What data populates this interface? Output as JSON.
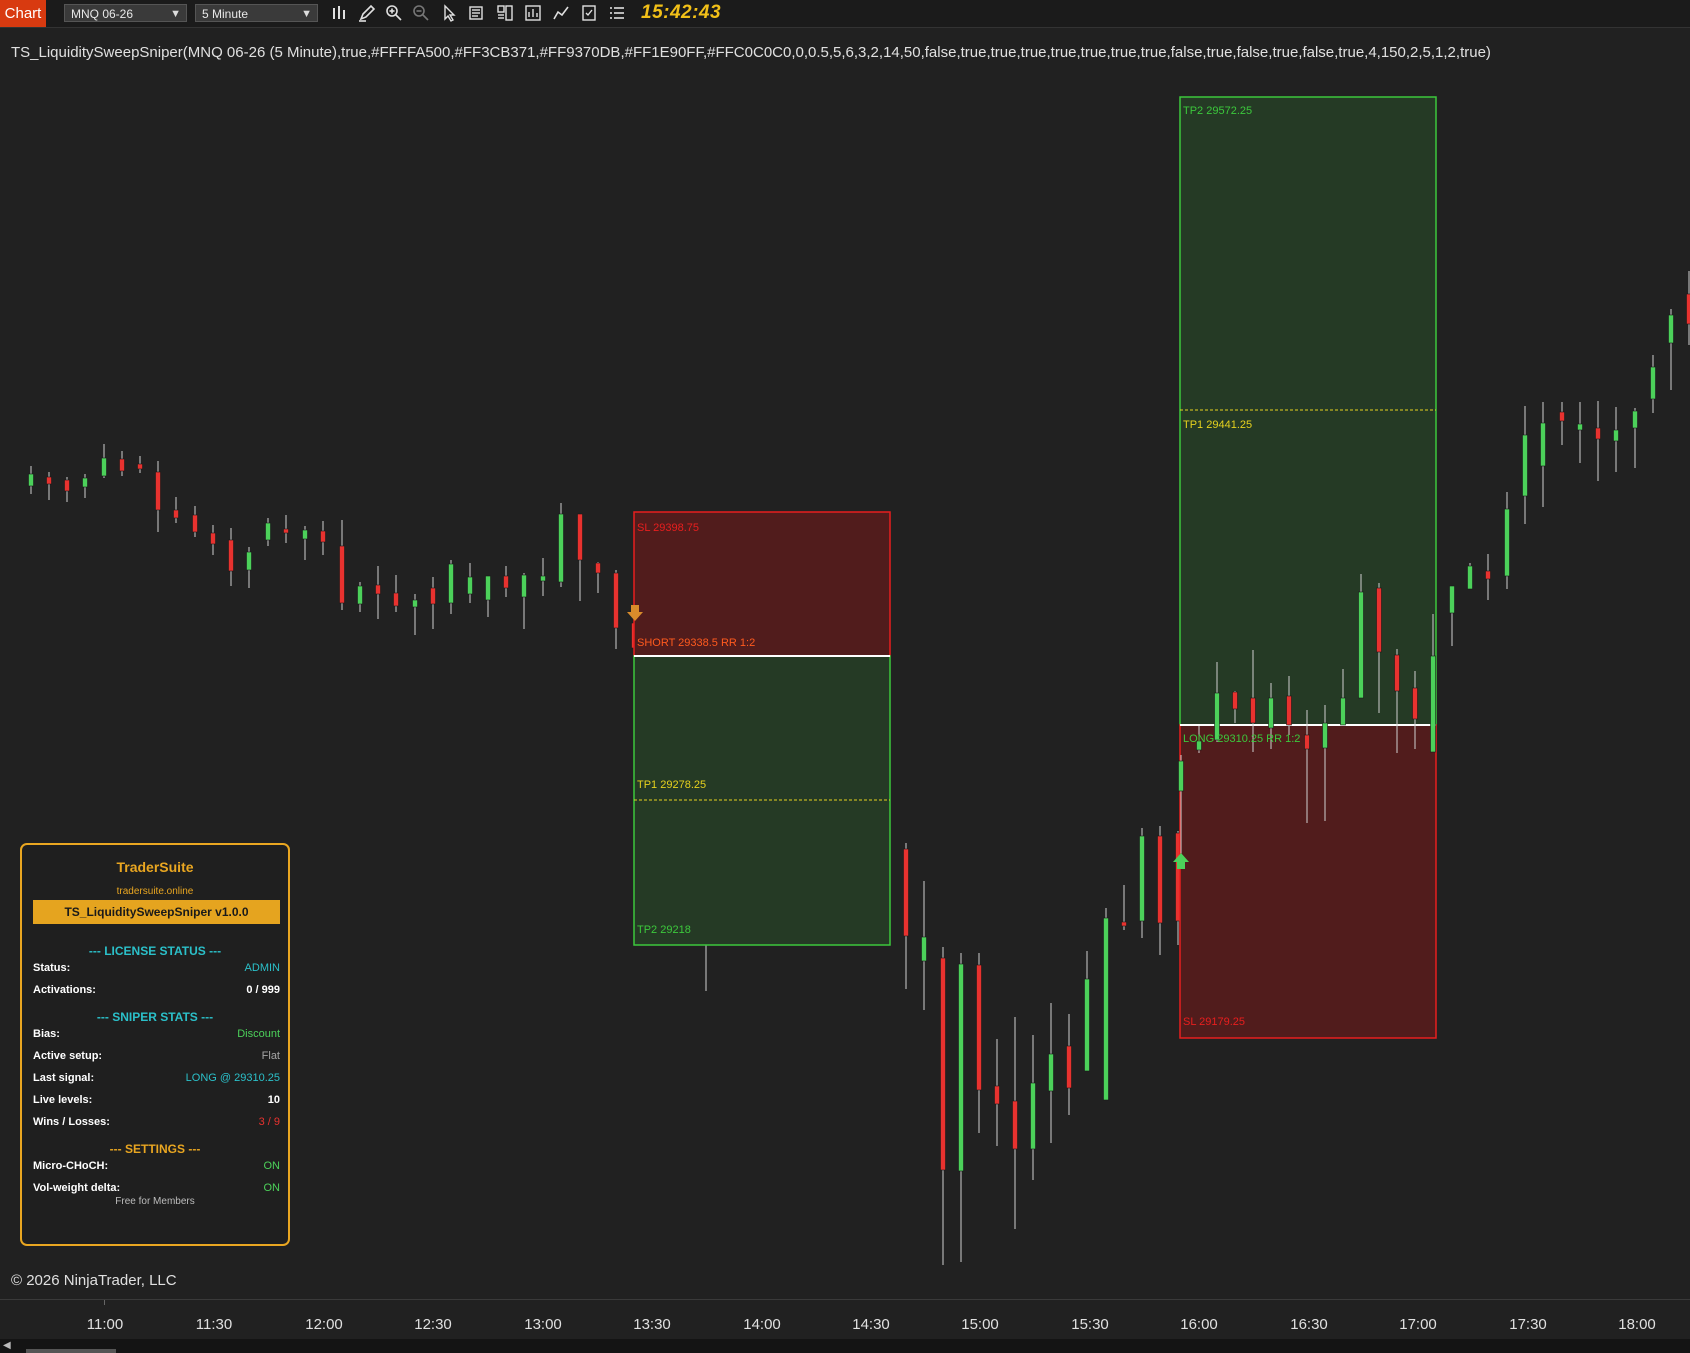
{
  "toolbar": {
    "tab_label": "Chart",
    "instrument": "MNQ 06-26",
    "interval": "5 Minute",
    "clock": "15:42:43"
  },
  "indicator_line": "TS_LiquiditySweepSniper(MNQ 06-26 (5 Minute),true,#FFFFA500,#FF3CB371,#FF9370DB,#FF1E90FF,#FFC0C0C0,0,0.5,5,6,3,2,14,50,false,true,true,true,true,true,true,true,false,true,false,true,false,true,4,150,2,5,1,2,true)",
  "copyright": "© 2026 NinjaTrader, LLC",
  "time_axis": [
    "11:00",
    "11:30",
    "12:00",
    "12:30",
    "13:00",
    "13:30",
    "14:00",
    "14:30",
    "15:00",
    "15:30",
    "16:00",
    "16:30",
    "17:00",
    "17:30",
    "18:00"
  ],
  "colors": {
    "up": "#4cd15a",
    "down": "#e8322f",
    "profit_fill": "#253a25",
    "profit_border": "#3cc83c",
    "loss_fill": "#511c1c",
    "loss_border": "#e81e1e",
    "tp1_line": "#e6d21e",
    "accent": "#e9a621"
  },
  "trades": [
    {
      "side": "short",
      "sl_label": "SL 29398.75",
      "entry_label": "SHORT 29338.5  RR 1:2",
      "tp1_label": "TP1 29278.25",
      "tp2_label": "TP2 29218"
    },
    {
      "side": "long",
      "sl_label": "SL 29179.25",
      "entry_label": "LONG 29310.25  RR 1:2",
      "tp1_label": "TP1 29441.25",
      "tp2_label": "TP2 29572.25"
    }
  ],
  "panel": {
    "title": "TraderSuite",
    "url": "tradersuite.online",
    "banner": "TS_LiquiditySweepSniper  v1.0.0",
    "license_header": "--- LICENSE STATUS ---",
    "status_label": "Status:",
    "status_value": "ADMIN",
    "activations_label": "Activations:",
    "activations_value": "0 / 999",
    "stats_header": "--- SNIPER STATS ---",
    "bias_label": "Bias:",
    "bias_value": "Discount",
    "active_label": "Active setup:",
    "active_value": "Flat",
    "last_label": "Last signal:",
    "last_value": "LONG @ 29310.25",
    "levels_label": "Live levels:",
    "levels_value": "10",
    "wl_label": "Wins / Losses:",
    "wl_value": "3 / 9",
    "settings_header": "--- SETTINGS ---",
    "choch_label": "Micro-CHoCH:",
    "choch_value": "ON",
    "vwd_label": "Vol-weight delta:",
    "vwd_value": "ON",
    "footer": "Free for Members"
  }
}
